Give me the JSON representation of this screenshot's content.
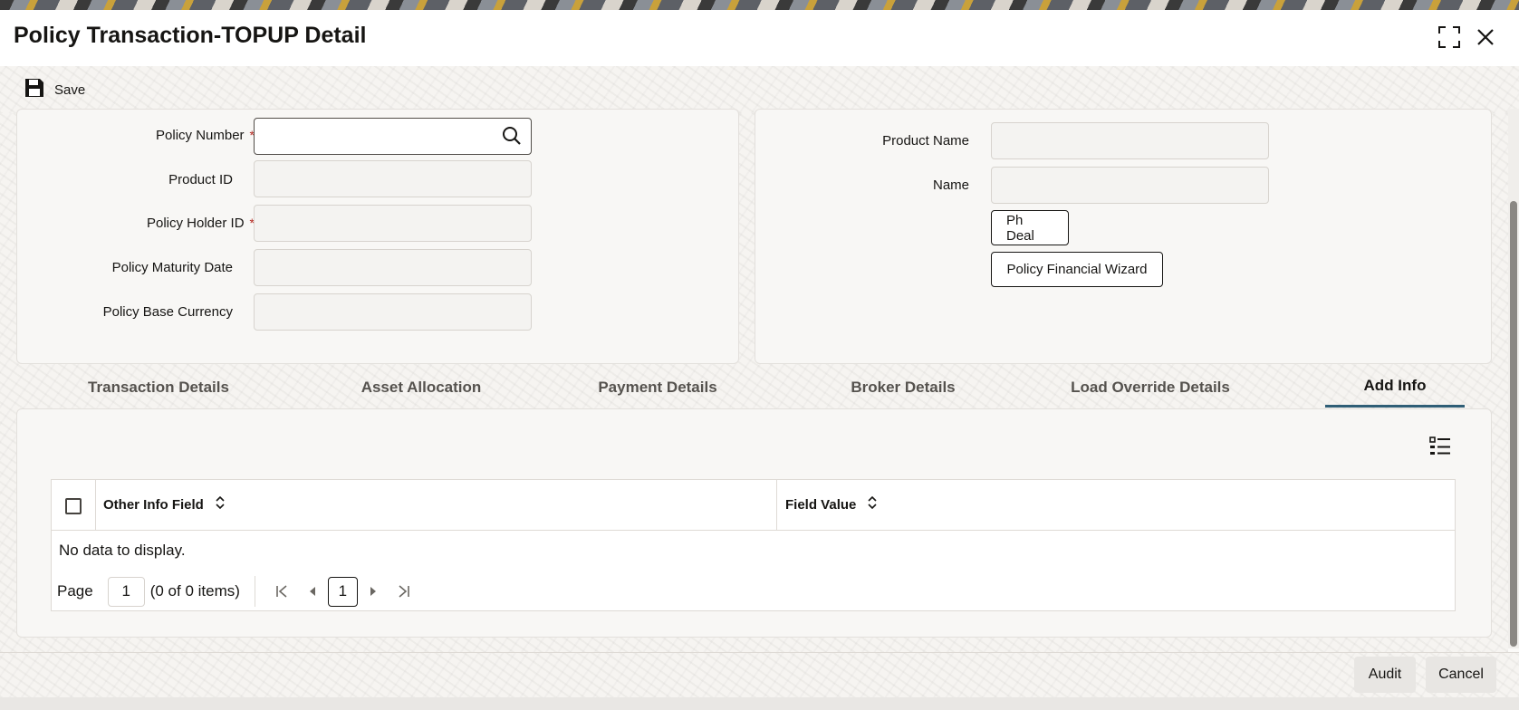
{
  "window": {
    "title": "Policy Transaction-TOPUP Detail",
    "expand_icon": "expand-icon",
    "close_icon": "close-icon"
  },
  "toolbar": {
    "save_label": "Save",
    "save_icon": "floppy-disk-icon"
  },
  "left_panel": {
    "fields": [
      {
        "label": "Policy Number",
        "required": true,
        "value": ""
      },
      {
        "label": "Product ID",
        "required": false,
        "value": ""
      },
      {
        "label": "Policy Holder ID",
        "required": true,
        "value": ""
      },
      {
        "label": "Policy Maturity Date",
        "required": false,
        "value": ""
      },
      {
        "label": "Policy Base Currency",
        "required": false,
        "value": ""
      }
    ],
    "required_mark": "*",
    "search_icon": "search-icon"
  },
  "right_panel": {
    "fields": [
      {
        "label": "Product Name",
        "value": ""
      },
      {
        "label": "Name",
        "value": ""
      }
    ],
    "buttons": [
      "Ph Deal",
      "Policy Financial Wizard"
    ]
  },
  "tabs": [
    {
      "label": "Transaction Details",
      "active": false
    },
    {
      "label": "Asset Allocation",
      "active": false
    },
    {
      "label": "Payment Details",
      "active": false
    },
    {
      "label": "Broker Details",
      "active": false
    },
    {
      "label": "Load Override Details",
      "active": false
    },
    {
      "label": "Add Info",
      "active": true
    }
  ],
  "grid": {
    "columns": [
      "Other Info Field",
      "Field Value"
    ],
    "empty_text": "No data to display.",
    "pager": {
      "page_label": "Page",
      "page_value": "1",
      "items_text": "(0 of 0 items)",
      "current_page": "1"
    },
    "column_menu_icon": "list-settings-icon"
  },
  "footer": {
    "audit_label": "Audit",
    "cancel_label": "Cancel"
  }
}
